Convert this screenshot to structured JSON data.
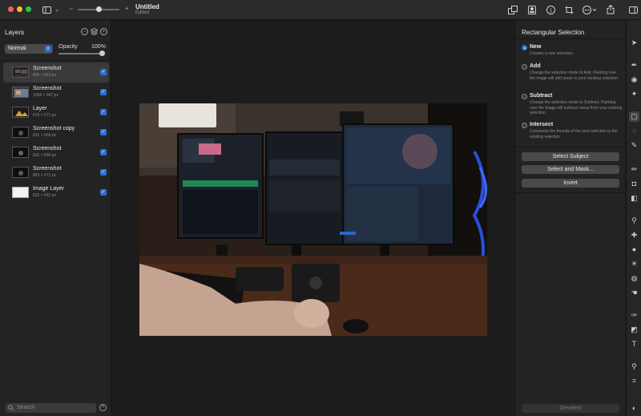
{
  "window": {
    "title": "Untitled",
    "subtitle": "Edited"
  },
  "layers_panel": {
    "title": "Layers",
    "blend_mode": "Normal",
    "opacity_label": "Opacity",
    "opacity_value": "100%",
    "layers": [
      {
        "name": "Screenshot",
        "size": "839 × 663 px",
        "selected": true,
        "thumb": "photo"
      },
      {
        "name": "Screenshot",
        "size": "1068 × 847 px",
        "selected": false,
        "thumb": "screen"
      },
      {
        "name": "Layer",
        "size": "679 × 571 px",
        "selected": false,
        "thumb": "art"
      },
      {
        "name": "Screenshot copy",
        "size": "831 × 656 px",
        "selected": false,
        "thumb": "dark"
      },
      {
        "name": "Screenshot",
        "size": "831 × 656 px",
        "selected": false,
        "thumb": "dark"
      },
      {
        "name": "Screenshot",
        "size": "853 × 671 px",
        "selected": false,
        "thumb": "dark"
      },
      {
        "name": "Image Layer",
        "size": "812 × 642 px",
        "selected": false,
        "thumb": "white"
      }
    ],
    "search_placeholder": "Search"
  },
  "selection_panel": {
    "title": "Rectangular Selection",
    "options": [
      {
        "title": "New",
        "desc": "Creates a new selection.",
        "selected": true
      },
      {
        "title": "Add",
        "desc": "Change the selection mode to Add. Painting over the image will add areas to your existing selection.",
        "selected": false
      },
      {
        "title": "Subtract",
        "desc": "Change the selection mode to Subtract. Painting over the image will subtract areas from your existing selection.",
        "selected": false
      },
      {
        "title": "Intersect",
        "desc": "Constrains the bounds of the next selection to the existing selection.",
        "selected": false
      }
    ],
    "buttons": {
      "select_subject": "Select Subject",
      "select_and_mask": "Select and Mask...",
      "invert": "Invert",
      "deselect": "Deselect"
    }
  },
  "colors": {
    "accent": "#2f6fd6",
    "panel": "#232323",
    "canvas": "#1c1c1c"
  },
  "icons": {
    "toolbar": [
      "sidebar-icon",
      "chevron-down-icon",
      "zoom-slider",
      "arrange-icon",
      "portrait-icon",
      "info-icon",
      "crop-icon",
      "more-icon",
      "share-icon",
      "panel-toggle-icon"
    ],
    "tools": [
      "arrow-select-icon",
      "pen-icon",
      "retouch-icon",
      "magic-icon",
      "rect-select-icon",
      "lasso-icon",
      "quick-select-icon",
      "brush-icon",
      "bucket-icon",
      "eraser-icon",
      "clone-icon",
      "heal-icon",
      "blur-icon",
      "dodge-icon",
      "smudge-icon",
      "hand-smudge-icon",
      "vector-pen-icon",
      "shapes-icon",
      "type-icon",
      "zoom-icon",
      "crop-tool-icon",
      "color-icon"
    ]
  }
}
